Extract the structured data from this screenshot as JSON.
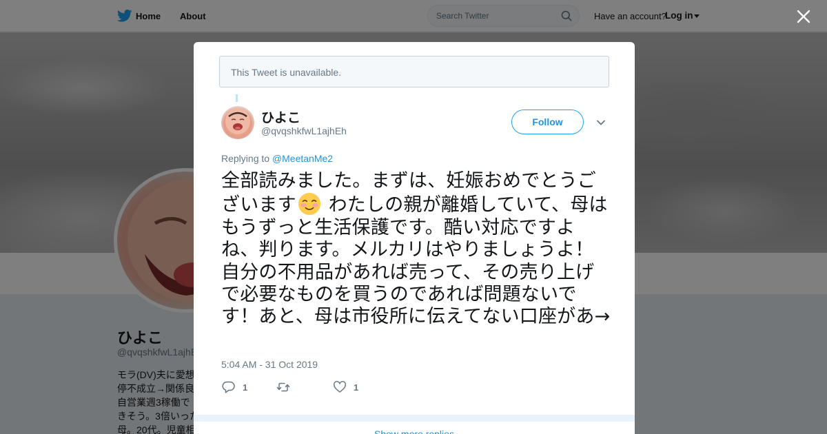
{
  "nav": {
    "home_label": "Home",
    "about_label": "About",
    "search_placeholder": "Search Twitter",
    "have_account": "Have an account?",
    "login_label": "Log in",
    "brand_color": "#1da1f2"
  },
  "profile": {
    "name": "ひよこ",
    "handle": "@qvqshkfwL1ajhEh",
    "bio": "モラ(DV)夫に愛想\n停不成立→関係良\n自営業週3稼働で\nきそう。3倍いった\n母。20代。児童相"
  },
  "modal": {
    "unavailable_text": "This Tweet is unavailable.",
    "tweet": {
      "author_name": "ひよこ",
      "author_handle": "@qvqshkfwL1ajhEh",
      "follow_label": "Follow",
      "replying_prefix": "Replying to ",
      "replying_to": "@MeetanMe2",
      "text_part1": "全部読みました。まずは、妊娠おめでとうございます",
      "emoji": "smiling-face-with-blush-emoji",
      "text_part2": " わたしの親が離婚していて、母はもうずっと生活保護です。酷い対応ですよね、判ります。メルカリはやりましょうよ！自分の不用品があれば売って、その売り上げで必要なものを買うのであれば問題ないです！あと、母は市役所に伝えてない口座があ→",
      "timestamp": "5:04 AM - 31 Oct 2019",
      "reply_count": "1",
      "retweet_count": "",
      "like_count": "1"
    },
    "footer_link": "Show more replies"
  }
}
